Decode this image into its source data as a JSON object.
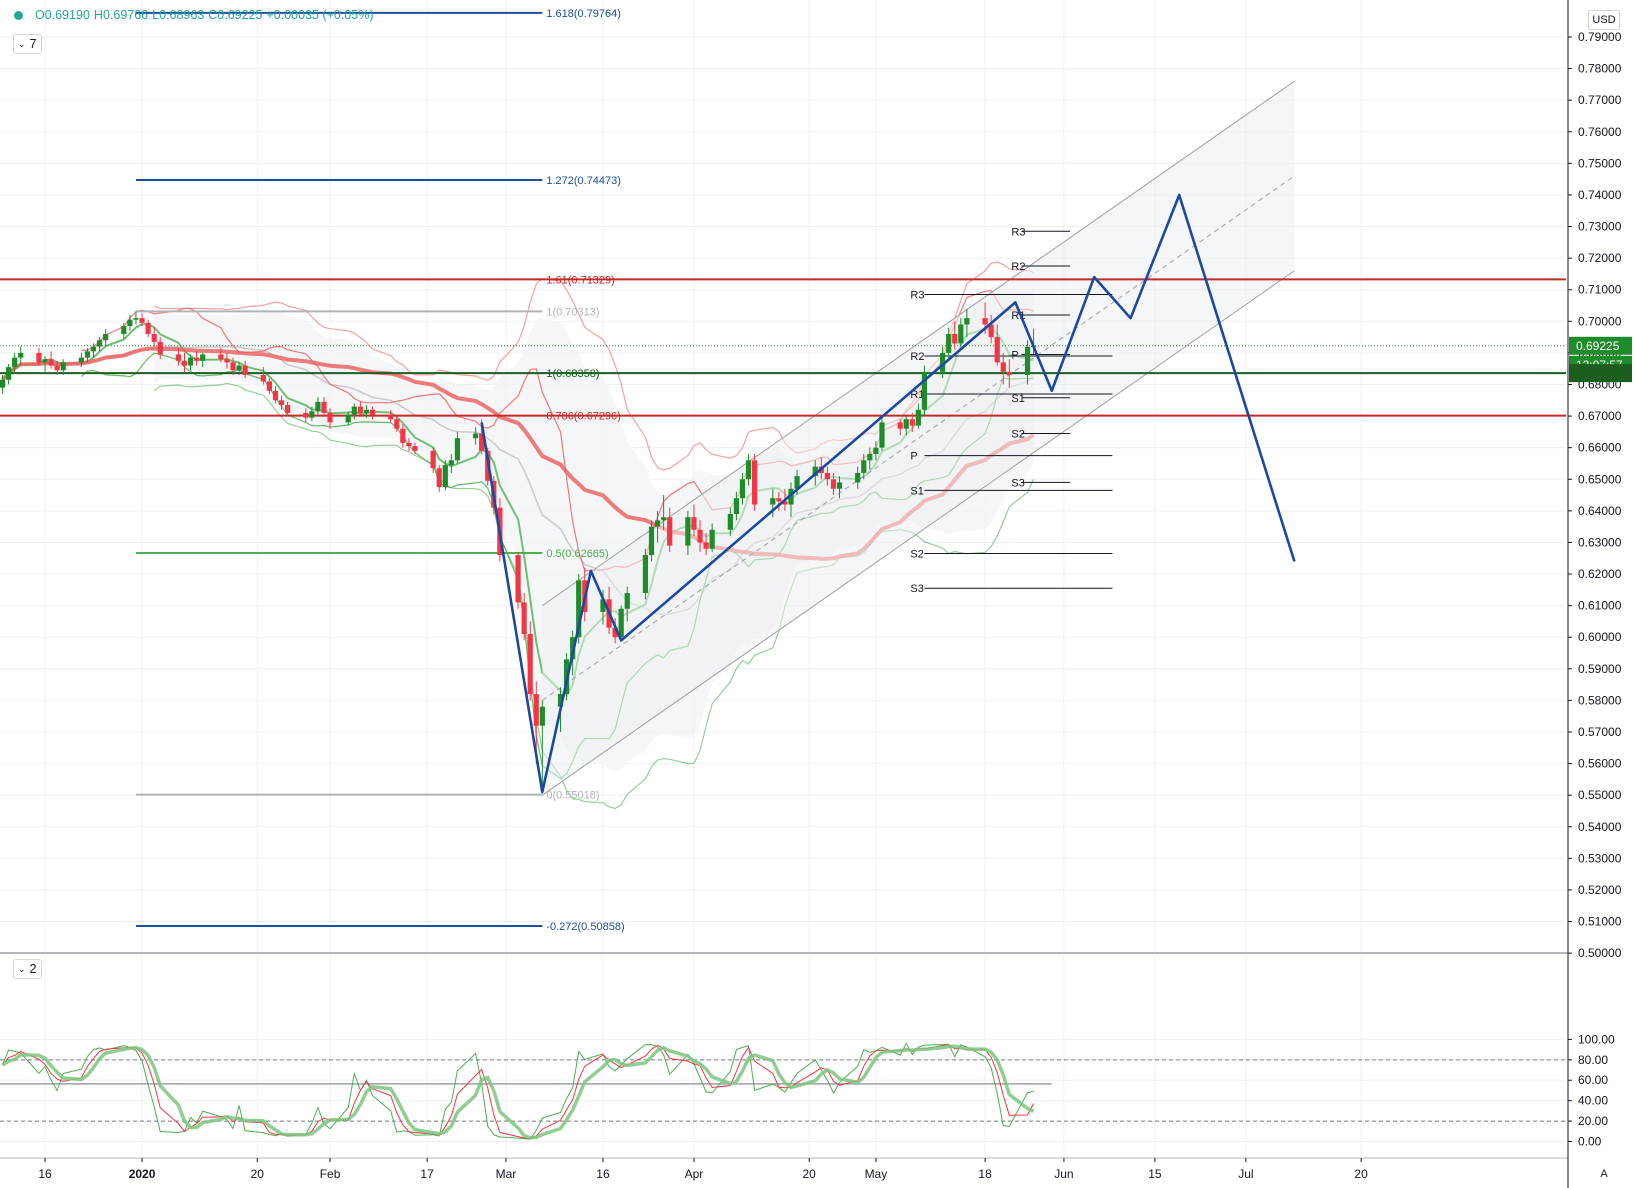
{
  "header": {
    "ohlc": {
      "open": "O0.69190",
      "high": "H0.69766",
      "low": "L0.68963",
      "close": "C0.69225",
      "change": "+0.00035 (+0.05%)"
    },
    "main_study_toggle": "7",
    "osc_study_toggle": "2",
    "currency": "USD",
    "auto_label": "A"
  },
  "colors": {
    "up": "#1e8c2a",
    "down": "#f23645",
    "bb_red": "#f0635f",
    "bb_green": "#4caf50",
    "fib_blue": "#1f4e9c",
    "pattern_blue": "#1c48a0",
    "grid": "#eef0f3",
    "last_price_bg": "#1e8c2a"
  },
  "chart_data": {
    "type": "candlestick",
    "symbol_quote": "USD",
    "ylim": [
      0.5,
      0.79
    ],
    "ytick_labels": [
      "0.79000",
      "0.78000",
      "0.77000",
      "0.76000",
      "0.75000",
      "0.74000",
      "0.73000",
      "0.72000",
      "0.71000",
      "0.70000",
      "0.69000",
      "0.68000",
      "0.67000",
      "0.66000",
      "0.65000",
      "0.64000",
      "0.63000",
      "0.62000",
      "0.61000",
      "0.60000",
      "0.59000",
      "0.58000",
      "0.57000",
      "0.56000",
      "0.55000",
      "0.54000",
      "0.53000",
      "0.52000",
      "0.51000",
      "0.50000"
    ],
    "yticks": [
      0.79,
      0.78,
      0.77,
      0.76,
      0.75,
      0.74,
      0.73,
      0.72,
      0.71,
      0.7,
      0.69,
      0.68,
      0.67,
      0.66,
      0.65,
      0.64,
      0.63,
      0.62,
      0.61,
      0.6,
      0.59,
      0.58,
      0.57,
      0.56,
      0.55,
      0.54,
      0.53,
      0.52,
      0.51,
      0.5
    ],
    "x_axis_days": [
      -16,
      230
    ],
    "xtick_labels": [
      "16",
      "2020",
      "20",
      "Feb",
      "17",
      "Mar",
      "16",
      "Apr",
      "20",
      "May",
      "18",
      "Jun",
      "15",
      "Jul",
      "20"
    ],
    "xtick_days": [
      -16,
      0,
      19,
      31,
      47,
      60,
      76,
      91,
      110,
      121,
      139,
      152,
      167,
      182,
      201
    ],
    "last_price": {
      "label": "0.69225",
      "value": 0.69225,
      "timer": "12:07:57"
    },
    "candles": [
      [
        -23,
        0.679,
        0.683,
        0.677,
        0.6815
      ],
      [
        -22,
        0.6815,
        0.6865,
        0.68,
        0.6855
      ],
      [
        -21,
        0.6855,
        0.69,
        0.6835,
        0.6885
      ],
      [
        -20,
        0.6885,
        0.692,
        0.686,
        0.69
      ],
      [
        -17,
        0.69,
        0.6915,
        0.686,
        0.687
      ],
      [
        -16,
        0.687,
        0.689,
        0.684,
        0.688
      ],
      [
        -15,
        0.688,
        0.6905,
        0.685,
        0.686
      ],
      [
        -14,
        0.686,
        0.6875,
        0.683,
        0.6845
      ],
      [
        -13,
        0.6845,
        0.688,
        0.683,
        0.687
      ],
      [
        -10,
        0.687,
        0.69,
        0.6855,
        0.6885
      ],
      [
        -9,
        0.6885,
        0.6915,
        0.687,
        0.6905
      ],
      [
        -8,
        0.6905,
        0.693,
        0.6885,
        0.692
      ],
      [
        -7,
        0.692,
        0.695,
        0.6905,
        0.694
      ],
      [
        -6,
        0.694,
        0.6975,
        0.692,
        0.696
      ],
      [
        -3,
        0.696,
        0.6995,
        0.6945,
        0.6985
      ],
      [
        -2,
        0.6985,
        0.702,
        0.697,
        0.7005
      ],
      [
        -1,
        0.7005,
        0.7032,
        0.699,
        0.701
      ],
      [
        0,
        0.701,
        0.7025,
        0.6985,
        0.6995
      ],
      [
        1,
        0.6995,
        0.7005,
        0.695,
        0.696
      ],
      [
        2,
        0.696,
        0.698,
        0.692,
        0.6935
      ],
      [
        3,
        0.6935,
        0.695,
        0.688,
        0.6895
      ],
      [
        6,
        0.6895,
        0.6915,
        0.686,
        0.6875
      ],
      [
        7,
        0.6875,
        0.69,
        0.684,
        0.686
      ],
      [
        8,
        0.686,
        0.6895,
        0.6845,
        0.6885
      ],
      [
        9,
        0.6885,
        0.6905,
        0.686,
        0.6875
      ],
      [
        10,
        0.6875,
        0.69,
        0.6855,
        0.6895
      ],
      [
        13,
        0.6895,
        0.6915,
        0.687,
        0.688
      ],
      [
        14,
        0.688,
        0.69,
        0.685,
        0.687
      ],
      [
        15,
        0.687,
        0.6885,
        0.683,
        0.6845
      ],
      [
        16,
        0.6845,
        0.687,
        0.683,
        0.686
      ],
      [
        17,
        0.686,
        0.6875,
        0.682,
        0.683
      ],
      [
        20,
        0.683,
        0.6855,
        0.68,
        0.681
      ],
      [
        21,
        0.681,
        0.682,
        0.677,
        0.678
      ],
      [
        22,
        0.678,
        0.6795,
        0.674,
        0.675
      ],
      [
        23,
        0.675,
        0.6765,
        0.672,
        0.6735
      ],
      [
        24,
        0.6735,
        0.6745,
        0.67,
        0.671
      ],
      [
        27,
        0.671,
        0.6725,
        0.668,
        0.6695
      ],
      [
        28,
        0.6695,
        0.673,
        0.6685,
        0.6715
      ],
      [
        29,
        0.6715,
        0.676,
        0.6705,
        0.6745
      ],
      [
        30,
        0.6745,
        0.676,
        0.67,
        0.671
      ],
      [
        31,
        0.671,
        0.6725,
        0.666,
        0.668
      ],
      [
        34,
        0.668,
        0.6715,
        0.667,
        0.6705
      ],
      [
        35,
        0.6705,
        0.674,
        0.669,
        0.673
      ],
      [
        36,
        0.673,
        0.6745,
        0.67,
        0.671
      ],
      [
        37,
        0.671,
        0.6735,
        0.6695,
        0.672
      ],
      [
        38,
        0.672,
        0.673,
        0.669,
        0.6705
      ],
      [
        41,
        0.6705,
        0.672,
        0.668,
        0.669
      ],
      [
        42,
        0.669,
        0.6705,
        0.665,
        0.666
      ],
      [
        43,
        0.666,
        0.6675,
        0.66,
        0.6615
      ],
      [
        44,
        0.6615,
        0.663,
        0.659,
        0.6605
      ],
      [
        45,
        0.6605,
        0.6615,
        0.658,
        0.659
      ],
      [
        48,
        0.659,
        0.66,
        0.652,
        0.6535
      ],
      [
        49,
        0.6535,
        0.6545,
        0.646,
        0.6475
      ],
      [
        50,
        0.6475,
        0.656,
        0.6465,
        0.6545
      ],
      [
        51,
        0.6545,
        0.658,
        0.652,
        0.656
      ],
      [
        52,
        0.656,
        0.665,
        0.655,
        0.663
      ],
      [
        55,
        0.663,
        0.6665,
        0.661,
        0.6645
      ],
      [
        56,
        0.6645,
        0.669,
        0.658,
        0.659
      ],
      [
        57,
        0.659,
        0.66,
        0.648,
        0.6495
      ],
      [
        58,
        0.6495,
        0.651,
        0.639,
        0.641
      ],
      [
        59,
        0.641,
        0.644,
        0.624,
        0.626
      ],
      [
        62,
        0.626,
        0.627,
        0.609,
        0.611
      ],
      [
        63,
        0.611,
        0.614,
        0.599,
        0.601
      ],
      [
        64,
        0.601,
        0.605,
        0.58,
        0.582
      ],
      [
        65,
        0.582,
        0.586,
        0.56,
        0.572
      ],
      [
        66,
        0.572,
        0.58,
        0.551,
        0.578
      ],
      [
        69,
        0.578,
        0.584,
        0.57,
        0.582
      ],
      [
        70,
        0.582,
        0.595,
        0.58,
        0.593
      ],
      [
        71,
        0.593,
        0.602,
        0.588,
        0.6
      ],
      [
        72,
        0.6,
        0.62,
        0.598,
        0.618
      ],
      [
        73,
        0.618,
        0.622,
        0.605,
        0.608
      ],
      [
        76,
        0.608,
        0.615,
        0.604,
        0.612
      ],
      [
        77,
        0.612,
        0.616,
        0.601,
        0.603
      ],
      [
        78,
        0.603,
        0.606,
        0.598,
        0.6
      ],
      [
        79,
        0.6,
        0.61,
        0.599,
        0.609
      ],
      [
        80,
        0.609,
        0.616,
        0.605,
        0.614
      ],
      [
        83,
        0.614,
        0.628,
        0.612,
        0.626
      ],
      [
        84,
        0.626,
        0.637,
        0.624,
        0.635
      ],
      [
        85,
        0.635,
        0.64,
        0.63,
        0.637
      ],
      [
        86,
        0.637,
        0.645,
        0.634,
        0.638
      ],
      [
        87,
        0.638,
        0.641,
        0.627,
        0.629
      ],
      [
        90,
        0.629,
        0.64,
        0.626,
        0.638
      ],
      [
        91,
        0.638,
        0.642,
        0.632,
        0.634
      ],
      [
        92,
        0.634,
        0.637,
        0.627,
        0.63
      ],
      [
        93,
        0.63,
        0.633,
        0.626,
        0.628
      ],
      [
        94,
        0.628,
        0.636,
        0.627,
        0.634
      ],
      [
        97,
        0.634,
        0.641,
        0.632,
        0.639
      ],
      [
        98,
        0.639,
        0.646,
        0.637,
        0.644
      ],
      [
        99,
        0.644,
        0.652,
        0.642,
        0.65
      ],
      [
        100,
        0.65,
        0.658,
        0.648,
        0.656
      ],
      [
        101,
        0.656,
        0.658,
        0.64,
        0.642
      ],
      [
        104,
        0.642,
        0.647,
        0.638,
        0.644
      ],
      [
        105,
        0.644,
        0.646,
        0.64,
        0.643
      ],
      [
        106,
        0.643,
        0.647,
        0.64,
        0.642
      ],
      [
        107,
        0.642,
        0.649,
        0.638,
        0.647
      ],
      [
        108,
        0.647,
        0.653,
        0.645,
        0.651
      ],
      [
        111,
        0.651,
        0.656,
        0.648,
        0.654
      ],
      [
        112,
        0.654,
        0.657,
        0.65,
        0.652
      ],
      [
        113,
        0.652,
        0.654,
        0.648,
        0.65
      ],
      [
        114,
        0.65,
        0.652,
        0.645,
        0.647
      ],
      [
        115,
        0.647,
        0.651,
        0.644,
        0.649
      ],
      [
        118,
        0.649,
        0.654,
        0.647,
        0.652
      ],
      [
        119,
        0.652,
        0.658,
        0.65,
        0.656
      ],
      [
        120,
        0.656,
        0.66,
        0.653,
        0.658
      ],
      [
        121,
        0.658,
        0.662,
        0.656,
        0.66
      ],
      [
        122,
        0.66,
        0.67,
        0.659,
        0.668
      ],
      [
        125,
        0.668,
        0.669,
        0.664,
        0.666
      ],
      [
        126,
        0.666,
        0.67,
        0.664,
        0.669
      ],
      [
        127,
        0.669,
        0.671,
        0.665,
        0.667
      ],
      [
        128,
        0.667,
        0.674,
        0.666,
        0.672
      ],
      [
        129,
        0.672,
        0.686,
        0.67,
        0.684
      ],
      [
        132,
        0.684,
        0.692,
        0.682,
        0.69
      ],
      [
        133,
        0.69,
        0.698,
        0.688,
        0.696
      ],
      [
        134,
        0.696,
        0.7,
        0.691,
        0.693
      ],
      [
        135,
        0.693,
        0.701,
        0.692,
        0.699
      ],
      [
        136,
        0.699,
        0.704,
        0.695,
        0.701
      ],
      [
        139,
        0.701,
        0.706,
        0.696,
        0.699
      ],
      [
        140,
        0.699,
        0.702,
        0.693,
        0.695
      ],
      [
        141,
        0.695,
        0.699,
        0.686,
        0.687
      ],
      [
        142,
        0.687,
        0.69,
        0.68,
        0.684
      ],
      [
        143,
        0.684,
        0.688,
        0.679,
        0.683
      ],
      [
        146,
        0.683,
        0.694,
        0.68,
        0.6919
      ],
      [
        147,
        0.6919,
        0.6977,
        0.6896,
        0.69225
      ]
    ],
    "fib_retracement_main": {
      "levels": [
        {
          "label": "1.618(0.79764)",
          "value": 0.79764
        },
        {
          "label": "1.272(0.74473)",
          "value": 0.74473
        },
        {
          "label": "1(0.70313)",
          "value": 0.70313
        },
        {
          "label": "0.5(0.62665)",
          "value": 0.62665
        },
        {
          "label": "0(0.55018)",
          "value": 0.55018
        },
        {
          "label": "-0.272(0.50858)",
          "value": 0.50858
        }
      ]
    },
    "fib_extension_right": {
      "levels": [
        {
          "label": "1.61(0.71329)",
          "value": 0.71329
        },
        {
          "label": "1(0.68358)",
          "value": 0.68358
        },
        {
          "label": "0.786(0.67296)",
          "value": 0.67015
        }
      ]
    },
    "pivot_levels": [
      {
        "label": "R3",
        "value": 0.7085
      },
      {
        "label": "R2",
        "value": 0.689
      },
      {
        "label": "R1",
        "value": 0.677
      },
      {
        "label": "P",
        "value": 0.6575
      },
      {
        "label": "S1",
        "value": 0.6465
      },
      {
        "label": "S2",
        "value": 0.6265
      },
      {
        "label": "S3",
        "value": 0.6155
      }
    ],
    "pivot_levels_short": [
      {
        "label": "R3",
        "value": 0.7285
      },
      {
        "label": "R2",
        "value": 0.7175
      },
      {
        "label": "R1",
        "value": 0.702
      },
      {
        "label": "P",
        "value": 0.6895
      },
      {
        "label": "S1",
        "value": 0.6758
      },
      {
        "label": "S2",
        "value": 0.6645
      },
      {
        "label": "S3",
        "value": 0.649
      }
    ],
    "projection_path": [
      [
        56,
        0.668
      ],
      [
        66,
        0.551
      ],
      [
        74,
        0.621
      ],
      [
        79,
        0.599
      ],
      [
        144,
        0.706
      ],
      [
        150,
        0.678
      ],
      [
        157,
        0.714
      ],
      [
        163,
        0.701
      ],
      [
        171,
        0.74
      ],
      [
        190,
        0.624
      ]
    ],
    "oscillator": {
      "ylim": [
        -5,
        105
      ],
      "ytick_labels": [
        "100.00",
        "80.00",
        "60.00",
        "40.00",
        "20.00",
        "0.00"
      ],
      "yticks": [
        100,
        80,
        60,
        40,
        20,
        0
      ],
      "levels": [
        80,
        20
      ],
      "mid_line": 56.5
    }
  }
}
